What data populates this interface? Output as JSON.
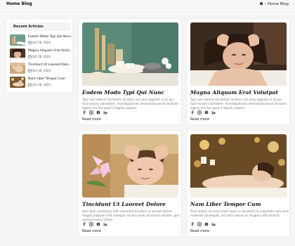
{
  "header": {
    "title": "Home Blog",
    "breadcrumb_icon": "home-icon",
    "breadcrumb_label": "Home Blog"
  },
  "sidebar": {
    "heading": "Recent Articles",
    "items": [
      {
        "title": "Eodem Modo Typi Qui Nunc",
        "date": "Oct 26, 2024"
      },
      {
        "title": "Magna Aliquam Erat Volut...",
        "date": "Oct 26, 2024"
      },
      {
        "title": "Tincidunt Ut Laoreet Dolo...",
        "date": "Oct 26, 2024"
      },
      {
        "title": "Nam Liber Tempor Cum",
        "date": "Oct 26, 2024"
      }
    ]
  },
  "posts": [
    {
      "title": "Eodem Modo Typi Qui Nunc",
      "excerpt": "Typi non habent claritatem insitam; est usus legentis in iis qui facit eorum claritatem. Investigationes demonstraverunt lectores legere me lius quod ii legunt saepius.",
      "read_more": "Read more",
      "image": "spa-stones-bamboo-candles"
    },
    {
      "title": "Magna Aliquam Erat Volutpat",
      "excerpt": "Typi non habent claritatem insitam; est usus legentis in iis qui facit eorum claritatem. Investigationes demonstraverunt lectores legere me lius quod ii legunt saepius.",
      "read_more": "Read more",
      "image": "head-massage-woman"
    },
    {
      "title": "Tincidunt Ut Laoreet Dolore",
      "excerpt": "Sed diam nonummy nibh euismod tincidunt ut laoreet dolore magna aliquam erat volutpat. Ut wisi enim ad minim veniam, quis nostrud exerci tation.",
      "read_more": "Read more",
      "image": "face-massage-lily"
    },
    {
      "title": "Nam Liber Tempor Cum",
      "excerpt": "Duis autem vel eum iriure dolor in hendrerit in vulputate velit esse molestie consequat, vel illum dolore eu feugiat nulla facilisis.",
      "read_more": "Read more",
      "image": "spa-woman-candles"
    }
  ],
  "social_icons": [
    "facebook-icon",
    "instagram-icon",
    "pinterest-icon",
    "linkedin-icon"
  ]
}
